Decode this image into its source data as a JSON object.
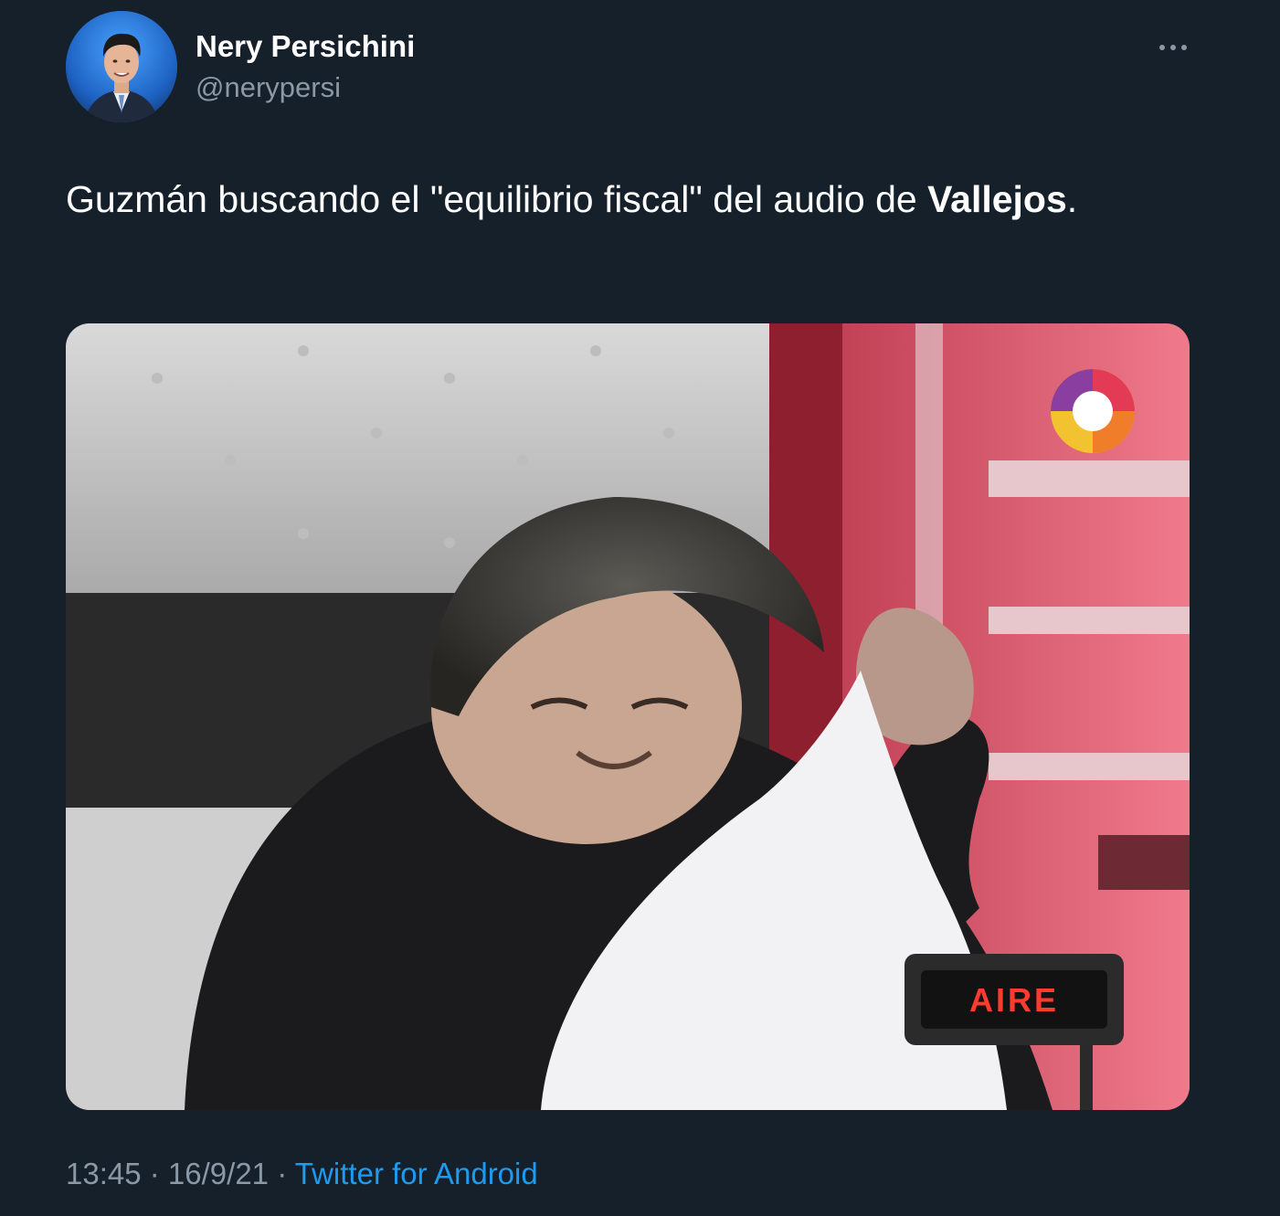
{
  "tweet": {
    "author": {
      "display_name": "Nery Persichini",
      "handle": "@nerypersi"
    },
    "more_icon": "more-horizontal-icon",
    "text_part1": "Guzmán buscando el \"equilibrio fiscal\" del audio de ",
    "text_bold": "Vallejos",
    "text_part2": ".",
    "media": {
      "overlay_label": "AIRE",
      "channel_logo": "telefe-logo"
    },
    "meta": {
      "time": "13:45",
      "separator1": " · ",
      "date": "16/9/21",
      "separator2": " · ",
      "source": "Twitter for Android"
    }
  },
  "colors": {
    "background": "#15202b",
    "text_primary": "#ffffff",
    "text_secondary": "#8b98a5",
    "link": "#1d9bf0"
  }
}
